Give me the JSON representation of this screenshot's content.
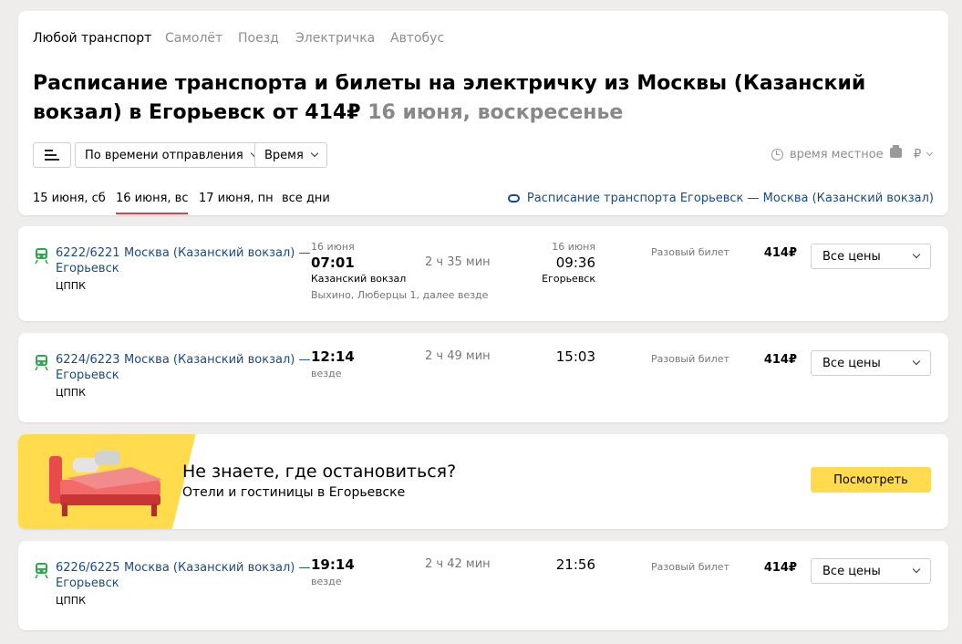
{
  "transport_tabs": [
    "Любой транспорт",
    "Самолёт",
    "Поезд",
    "Электричка",
    "Автобус"
  ],
  "title": {
    "main": "Расписание транспорта и билеты на электричку из Москвы (Казанский вокзал) в Егорьевск от 414₽",
    "date": "16 июня, воскресенье"
  },
  "filters": {
    "sort_label": "По времени отправления",
    "time_label": "Время"
  },
  "meta": {
    "local_time": "время местное",
    "currency": "₽"
  },
  "date_tabs": [
    "15 июня, сб",
    "16 июня, вс",
    "17 июня, пн",
    "все дни"
  ],
  "back_link": "Расписание транспорта Егорьевск — Москва (Казанский вокзал)",
  "trips": [
    {
      "number": "6222/6221",
      "route_line1": "Москва (Казанский вокзал) —",
      "route_line2": "Егорьевск",
      "carrier": "ЦППК",
      "dep_date": "16 июня",
      "dep_time": "07:01",
      "dep_station": "Казанский вокзал",
      "stops": "Выхино, Люберцы 1, далее везде",
      "duration": "2 ч 35 мин",
      "arr_date": "16 июня",
      "arr_time": "09:36",
      "arr_station": "Егорьевск",
      "ticket": "Разовый билет",
      "price": "414₽",
      "price_select": "Все цены"
    },
    {
      "number": "6224/6223",
      "route_line1": "Москва (Казанский вокзал) —",
      "route_line2": "Егорьевск",
      "carrier": "ЦППК",
      "dep_time": "12:14",
      "stops": "везде",
      "duration": "2 ч 49 мин",
      "arr_time": "15:03",
      "ticket": "Разовый билет",
      "price": "414₽",
      "price_select": "Все цены"
    },
    {
      "number": "6226/6225",
      "route_line1": "Москва (Казанский вокзал) —",
      "route_line2": "Егорьевск",
      "carrier": "ЦППК",
      "dep_time": "19:14",
      "stops": "везде",
      "duration": "2 ч 42 мин",
      "arr_time": "21:56",
      "ticket": "Разовый билет",
      "price": "414₽",
      "price_select": "Все цены"
    }
  ],
  "promo": {
    "title": "Не знаете, где остановиться?",
    "subtitle": "Отели и гостиницы в Егорьевске",
    "button": "Посмотреть"
  },
  "colors": {
    "accent_yellow": "#ffdb4d",
    "link_blue": "#1a4a8a",
    "train_green": "#2ea84f",
    "active_underline": "#e53c3c"
  }
}
